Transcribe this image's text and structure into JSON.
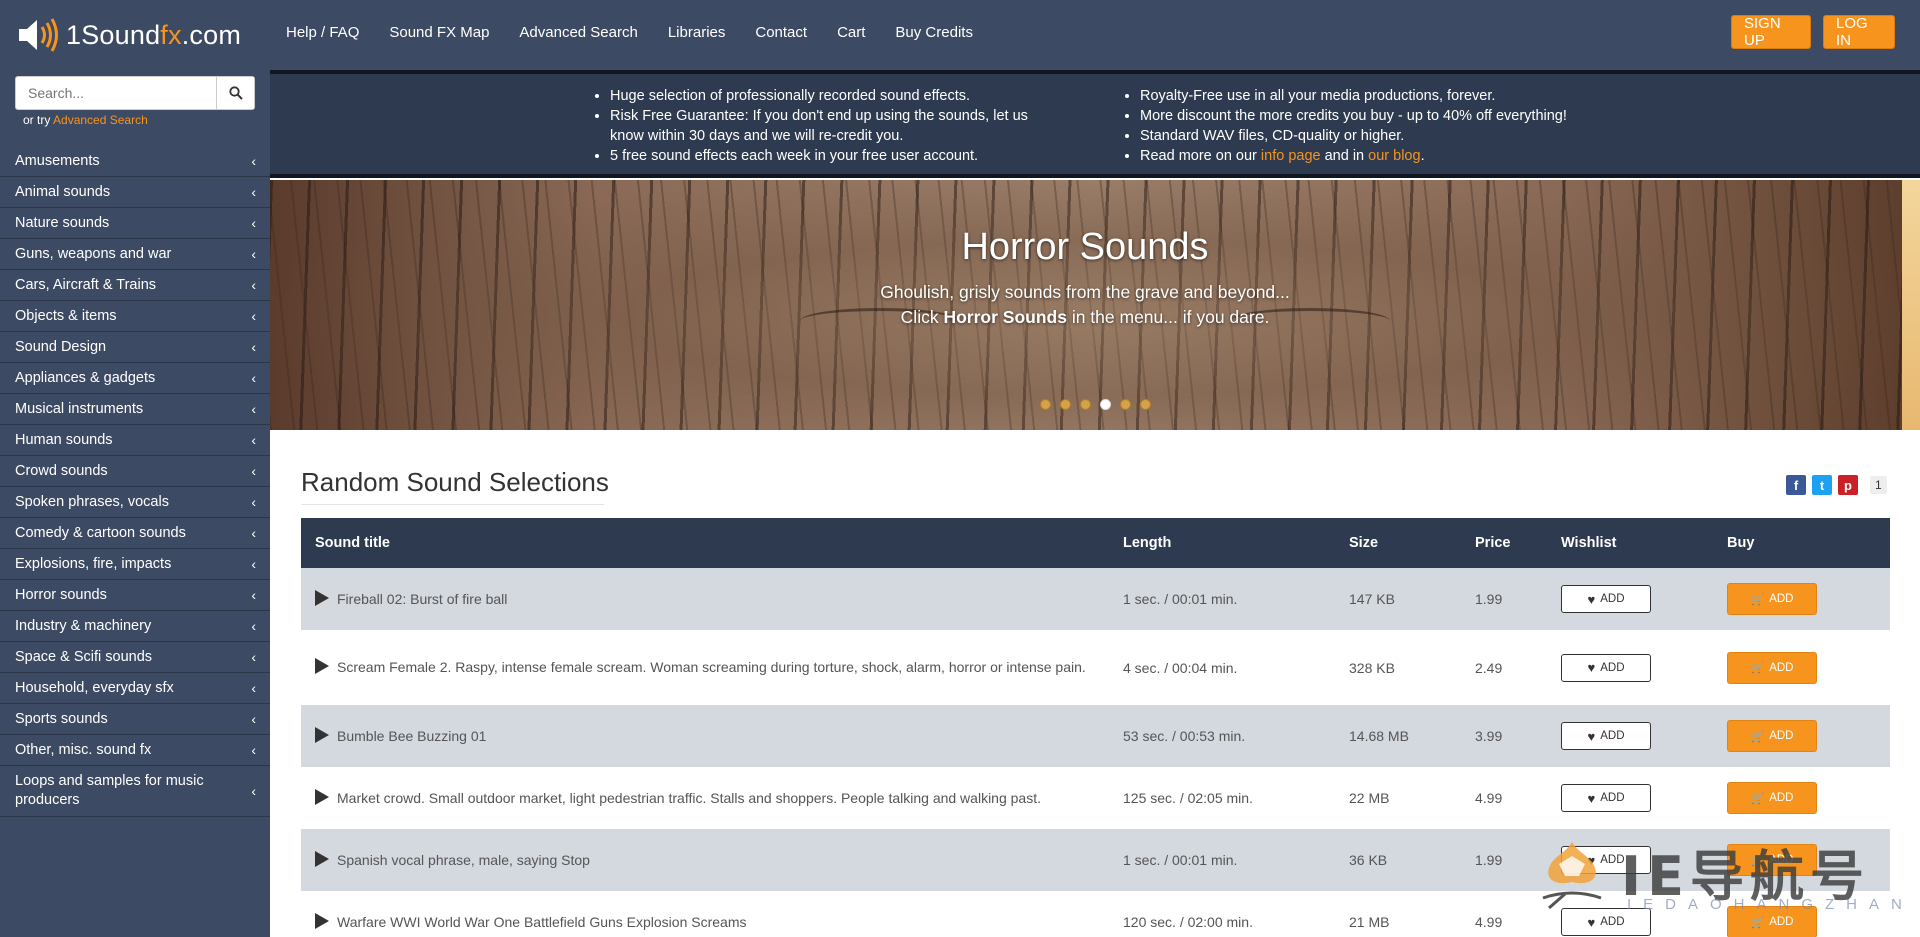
{
  "brand": {
    "name_prefix": "1Sound",
    "name_fx": "fx",
    "name_suffix": ".com"
  },
  "nav": [
    "Help / FAQ",
    "Sound FX Map",
    "Advanced Search",
    "Libraries",
    "Contact",
    "Cart",
    "Buy Credits"
  ],
  "auth": {
    "signup": "SIGN UP",
    "login": "LOG IN"
  },
  "search": {
    "placeholder": "Search...",
    "or_try": "or try",
    "advanced_link": "Advanced Search"
  },
  "categories": [
    "Amusements",
    "Animal sounds",
    "Nature sounds",
    "Guns, weapons and war",
    "Cars, Aircraft & Trains",
    "Objects & items",
    "Sound Design",
    "Appliances & gadgets",
    "Musical instruments",
    "Human sounds",
    "Crowd sounds",
    "Spoken phrases, vocals",
    "Comedy & cartoon sounds",
    "Explosions, fire, impacts",
    "Horror sounds",
    "Industry & machinery",
    "Space & Scifi sounds",
    "Household, everyday sfx",
    "Sports sounds",
    "Other, misc. sound fx",
    "Loops and samples for music producers"
  ],
  "info": {
    "left": [
      "Huge selection of professionally recorded sound effects.",
      "Risk Free Guarantee: If you don't end up using the sounds, let us know within 30 days and we will re-credit you.",
      "5 free sound effects each week in your free user account."
    ],
    "right": [
      "Royalty-Free use in all your media productions, forever.",
      "More discount the more credits you buy - up to 40% off everything!",
      "Standard WAV files, CD-quality or higher."
    ],
    "readmore_prefix": "Read more on our",
    "readmore_link1": "info page",
    "readmore_mid": "and in",
    "readmore_link2": "our blog",
    "readmore_suffix": "."
  },
  "banner": {
    "title": "Horror Sounds",
    "line1": "Ghoulish, grisly sounds from the grave and beyond...",
    "line2_prefix": "Click",
    "line2_bold": "Horror Sounds",
    "line2_suffix": "in the menu... if you dare.",
    "slide_count": 6,
    "active_slide": 4
  },
  "section": {
    "title": "Random Sound Selections"
  },
  "social": {
    "fb": "f",
    "tw": "t",
    "pi": "p",
    "count": "1"
  },
  "table": {
    "headers": {
      "title": "Sound title",
      "length": "Length",
      "size": "Size",
      "price": "Price",
      "wishlist": "Wishlist",
      "buy": "Buy"
    },
    "wish_label": "ADD",
    "buy_label": "ADD",
    "rows": [
      {
        "title": "Fireball 02: Burst of fire ball",
        "length": "1 sec. / 00:01 min.",
        "size": "147 KB",
        "price": "1.99"
      },
      {
        "title": "Scream Female 2. Raspy, intense female scream. Woman screaming during torture, shock, alarm, horror or intense pain.",
        "length": "4 sec. / 00:04 min.",
        "size": "328 KB",
        "price": "2.49"
      },
      {
        "title": "Bumble Bee Buzzing 01",
        "length": "53 sec. / 00:53 min.",
        "size": "14.68 MB",
        "price": "3.99"
      },
      {
        "title": "Market crowd. Small outdoor market, light pedestrian traffic. Stalls and shoppers. People talking and walking past.",
        "length": "125 sec. / 02:05 min.",
        "size": "22 MB",
        "price": "4.99"
      },
      {
        "title": "Spanish vocal phrase, male, saying Stop",
        "length": "1 sec. / 00:01 min.",
        "size": "36 KB",
        "price": "1.99"
      },
      {
        "title": "Warfare WWI World War One Battlefield Guns Explosion Screams",
        "length": "120 sec. / 02:00 min.",
        "size": "21 MB",
        "price": "4.99"
      }
    ]
  },
  "watermark": {
    "text": "IE导航号",
    "sub": "IEDAOHANGZHAN"
  },
  "colors": {
    "navy": "#3d4a63",
    "dark_navy": "#2e3a50",
    "accent": "#f7941d",
    "row_alt": "#d4d8df"
  }
}
